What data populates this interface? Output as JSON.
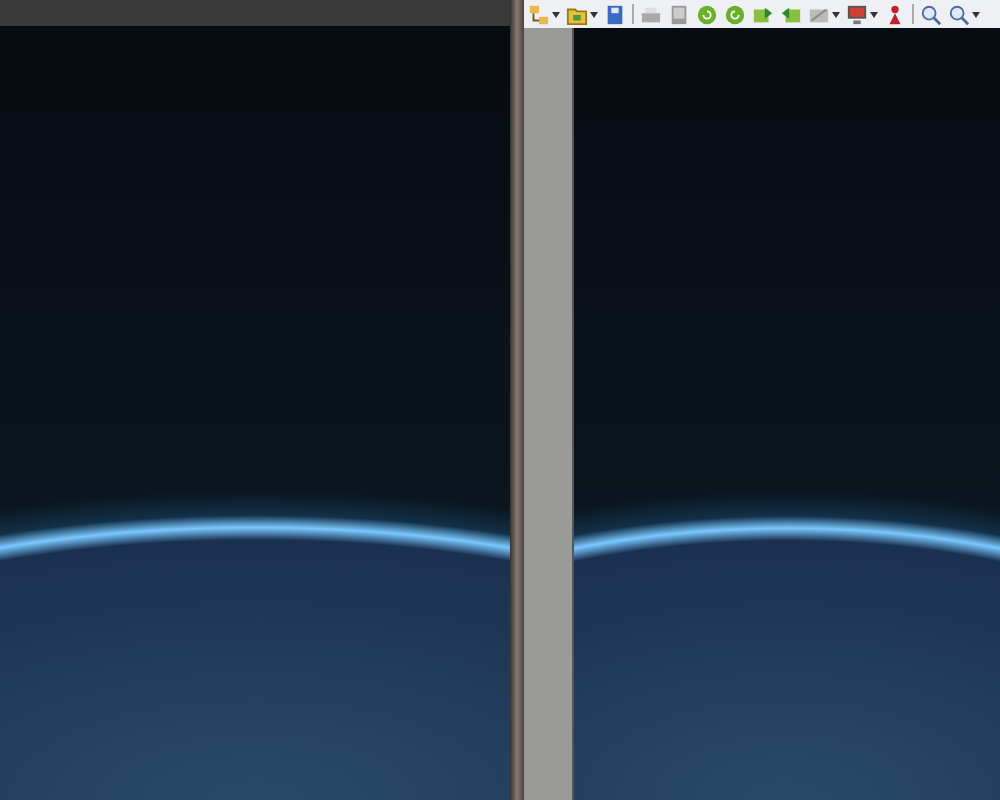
{
  "toolbar": {
    "buttons": [
      {
        "kind": "tree"
      },
      {
        "kind": "dropdown"
      },
      {
        "kind": "folder"
      },
      {
        "kind": "dropdown"
      },
      {
        "kind": "save"
      },
      {
        "kind": "separator"
      },
      {
        "kind": "print"
      },
      {
        "kind": "scan"
      },
      {
        "kind": "rotate-left"
      },
      {
        "kind": "rotate-right"
      },
      {
        "kind": "export"
      },
      {
        "kind": "import"
      },
      {
        "kind": "tools"
      },
      {
        "kind": "dropdown"
      },
      {
        "kind": "monitor"
      },
      {
        "kind": "dropdown"
      },
      {
        "kind": "figure"
      },
      {
        "kind": "separator"
      },
      {
        "kind": "zoom-in"
      },
      {
        "kind": "zoom"
      },
      {
        "kind": "dropdown"
      }
    ]
  }
}
